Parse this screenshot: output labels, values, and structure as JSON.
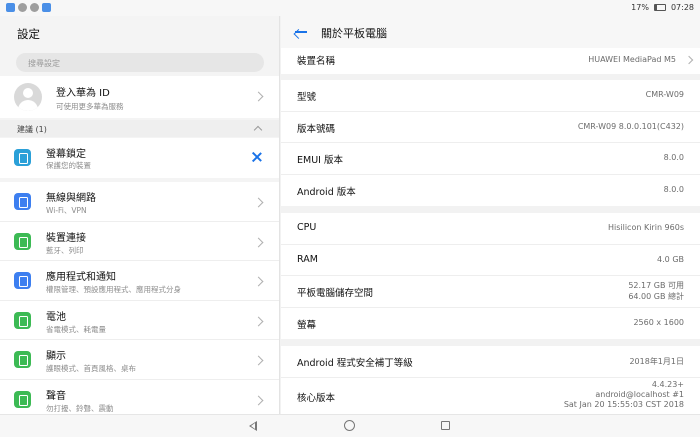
{
  "status_bar": {
    "battery": "17%",
    "time": "07:28",
    "app_icon_colors": [
      "#4a8fe7",
      "#9e9e9e",
      "#9e9e9e",
      "#4a8fe7"
    ]
  },
  "settings": {
    "title": "設定",
    "search_placeholder": "搜尋設定",
    "account": {
      "title": "登入華為 ID",
      "subtitle": "可使用更多華為服務"
    },
    "suggestions_header": "建議 (1)",
    "suggestion": {
      "title": "螢幕鎖定",
      "subtitle": "保護您的裝置",
      "icon": "lock-screen-icon",
      "icon_color": "#2aa0d8"
    },
    "items": [
      {
        "title": "無線與網路",
        "subtitle": "Wi-Fi、VPN",
        "icon": "wifi-icon",
        "color": "#3d7ff0"
      },
      {
        "title": "裝置連接",
        "subtitle": "藍牙、列印",
        "icon": "device-connect-icon",
        "color": "#3cba54"
      },
      {
        "title": "應用程式和通知",
        "subtitle": "權限管理、預設應用程式、應用程式分身",
        "icon": "apps-icon",
        "color": "#3d7ff0"
      },
      {
        "title": "電池",
        "subtitle": "省電模式、耗電量",
        "icon": "battery-icon",
        "color": "#3cba54"
      },
      {
        "title": "顯示",
        "subtitle": "護眼模式、首頁風格、桌布",
        "icon": "display-icon",
        "color": "#3cba54"
      },
      {
        "title": "聲音",
        "subtitle": "勿打擾、鈴聲、震動",
        "icon": "sound-icon",
        "color": "#3cba54"
      }
    ]
  },
  "about": {
    "title": "關於平板電腦",
    "group1": [
      {
        "label": "裝置名稱",
        "value": "HUAWEI MediaPad M5",
        "chevron": true
      }
    ],
    "group2": [
      {
        "label": "型號",
        "value": "CMR-W09"
      },
      {
        "label": "版本號碼",
        "value": "CMR-W09 8.0.0.101(C432)"
      },
      {
        "label": "EMUI 版本",
        "value": "8.0.0"
      },
      {
        "label": "Android 版本",
        "value": "8.0.0"
      }
    ],
    "group3": [
      {
        "label": "CPU",
        "value": "Hisilicon Kirin 960s"
      },
      {
        "label": "RAM",
        "value": "4.0 GB"
      },
      {
        "label": "平板電腦儲存空間",
        "value_line1": "52.17  GB 可用",
        "value_line2": "64.00  GB 總計"
      },
      {
        "label": "螢幕",
        "value": "2560 x 1600"
      }
    ],
    "group4": [
      {
        "label": "Android 程式安全補丁等級",
        "value": "2018年1月1日"
      },
      {
        "label": "核心版本",
        "value_line1": "4.4.23+",
        "value_line2": "android@localhost #1",
        "value_line3": "Sat Jan 20 15:55:03 CST 2018"
      }
    ]
  }
}
